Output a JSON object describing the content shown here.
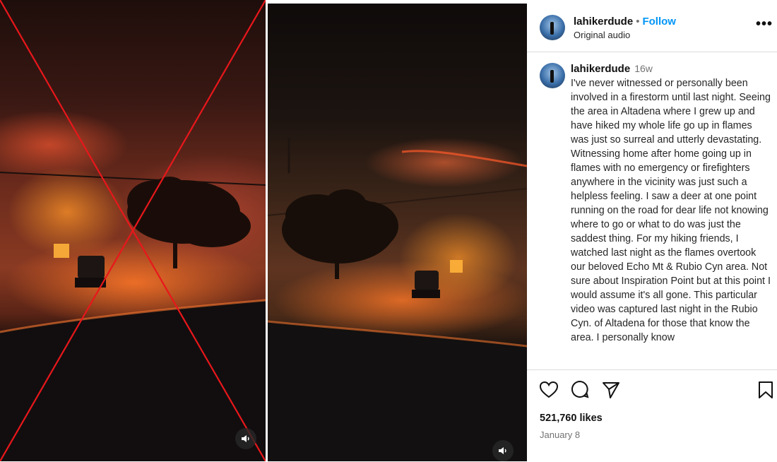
{
  "post": {
    "username": "lahikerdude",
    "follow_label": "Follow",
    "separator": "•",
    "audio_label": "Original audio",
    "more_label": "•••",
    "age": "16w",
    "caption": "I've never witnessed or personally been involved in a firestorm until last night. Seeing the area in Altadena where I grew up and have hiked my whole life go up in flames was just so surreal and utterly devastating. Witnessing home after home going up in flames with no emergency or firefighters anywhere in the vicinity was just such a helpless feeling. I saw a deer at one point running on the road for dear life not knowing where to go or what to do was just the saddest thing. For my hiking friends, I watched last night as the flames overtook our beloved Echo Mt & Rubio Cyn area. Not sure about Inspiration Point but at this point I would assume it's all gone. This particular video was captured last night in the Rubio Cyn. of Altadena for those that know the area. I personally know",
    "likes": "521,760 likes",
    "date": "January 8"
  },
  "icons": {
    "like": "heart-icon",
    "comment": "comment-icon",
    "share": "send-icon",
    "save": "bookmark-icon",
    "sound": "speaker-icon"
  },
  "colors": {
    "cross_mark": "#e8171b",
    "follow": "#0095f6"
  }
}
